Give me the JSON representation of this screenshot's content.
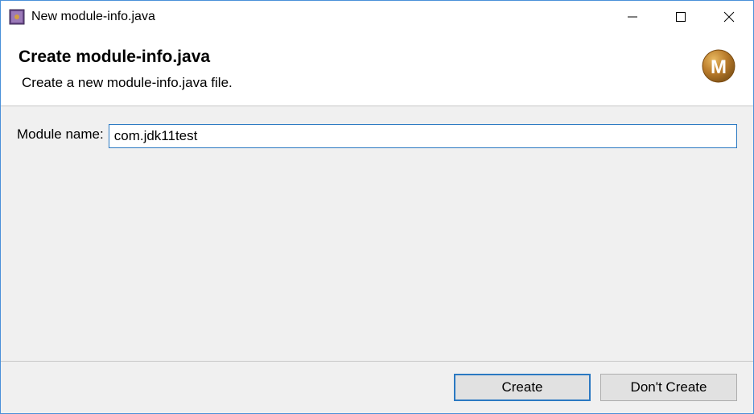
{
  "titlebar": {
    "title": "New module-info.java"
  },
  "header": {
    "title": "Create module-info.java",
    "subtitle": "Create a new module-info.java file."
  },
  "form": {
    "module_name_label": "Module name:",
    "module_name_value": "com.jdk11test"
  },
  "footer": {
    "create_label": "Create",
    "dont_create_label": "Don't Create"
  },
  "badge": {
    "letter": "M"
  }
}
